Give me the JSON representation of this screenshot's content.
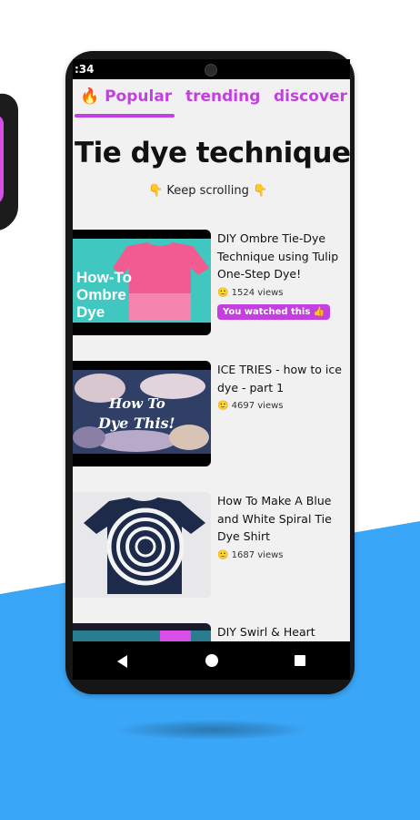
{
  "status_bar": {
    "time": ":34"
  },
  "tabs": [
    {
      "label": "🔥 Popular",
      "active": true
    },
    {
      "label": "trending",
      "active": false
    },
    {
      "label": "discover",
      "active": false
    }
  ],
  "page": {
    "title": "Tie dye techniques",
    "subtitle": "👇 Keep scrolling 👇"
  },
  "videos": [
    {
      "title": "DIY Ombre Tie-Dye Technique using Tulip One-Step Dye!",
      "views": "🙂 1524 views",
      "badge": "You watched this 👍",
      "thumb_text": "How-To Ombre Dye"
    },
    {
      "title": "ICE TRIES - how to ice dye - part 1",
      "views": "🙂 4697 views",
      "thumb_text": "How To Dye This!"
    },
    {
      "title": "How To Make A Blue and White Spiral Tie Dye Shirt",
      "views": "🙂 1687 views"
    },
    {
      "title": "DIY Swirl & Heart"
    }
  ],
  "colors": {
    "accent": "#c43fe0",
    "background_blue": "#3aa6f7",
    "screen_bg": "#f1f1f1"
  },
  "icons": [
    "back-icon",
    "home-icon",
    "recents-icon",
    "camera-icon"
  ]
}
